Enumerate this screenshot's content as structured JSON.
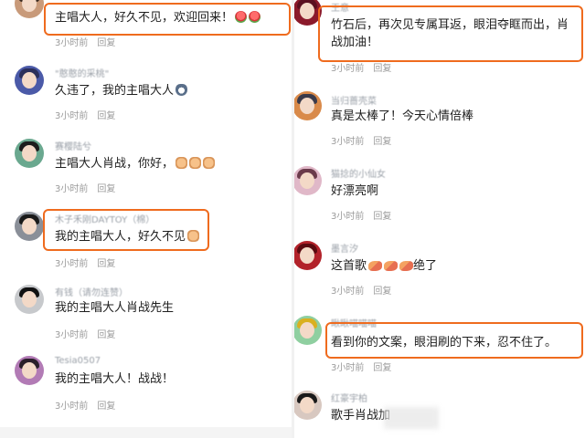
{
  "left_comments": [
    {
      "username": "",
      "text": "主唱大人，好久不见，欢迎回来！",
      "emojis": [
        "flower",
        "flower"
      ],
      "time": "3小时前",
      "reply": "回复",
      "avatar_hair": "#3a2a20",
      "avatar_bg": "#c89a7a"
    },
    {
      "username": "\"憨憨的采桃\"",
      "text": "久违了，我的主唱大人",
      "emojis": [
        "cat"
      ],
      "time": "3小时前",
      "reply": "回复",
      "avatar_hair": "#2b2f5a",
      "avatar_bg": "#4b5aa8"
    },
    {
      "username": "赛樱陆兮",
      "text": "主唱大人肖战，你好，",
      "emojis": [
        "fist",
        "fist",
        "fist"
      ],
      "time": "3小时前",
      "reply": "回复",
      "avatar_hair": "#1d1d1d",
      "avatar_bg": "#6aa88f"
    },
    {
      "username": "木子禾刚DAYTOY（棉）",
      "text": "我的主唱大人，好久不见",
      "emojis": [
        "fist"
      ],
      "time": "3小时前",
      "reply": "回复",
      "avatar_hair": "#1a1a1a",
      "avatar_bg": "#8a8f98"
    },
    {
      "username": "有钱（请勿连赞）",
      "text": "我的主唱大人肖战先生",
      "emojis": [],
      "time": "3小时前",
      "reply": "回复",
      "avatar_hair": "#111",
      "avatar_bg": "#c7c9cc"
    },
    {
      "username": "Tesia0507",
      "text": "我的主唱大人！战战！",
      "emojis": [],
      "time": "3小时前",
      "reply": "回复",
      "avatar_hair": "#2a1f2a",
      "avatar_bg": "#b27bb5"
    }
  ],
  "right_comments": [
    {
      "username": "王意",
      "text": "竹石后，再次见专属耳返，眼泪夺眶而出，肖战加油！",
      "emojis": [],
      "time": "3小时前",
      "reply": "回复",
      "avatar_hair": "#5a1020",
      "avatar_bg": "#8b1a2b"
    },
    {
      "username": "当归蔷壳菜",
      "text": "真是太棒了！今天心情倍棒",
      "emojis": [],
      "time": "3小时前",
      "reply": "回复",
      "avatar_hair": "#3a3a4a",
      "avatar_bg": "#d98a4a"
    },
    {
      "username": "猫捻的小仙女",
      "text": "好漂亮啊",
      "emojis": [],
      "time": "3小时前",
      "reply": "回复",
      "avatar_hair": "#6a3a4a",
      "avatar_bg": "#e0b8c8"
    },
    {
      "username": "墨言汐",
      "text": "这首歌",
      "text_after": "绝了",
      "emojis": [
        "bean",
        "bean",
        "bean"
      ],
      "time": "3小时前",
      "reply": "回复",
      "avatar_hair": "#5a0a10",
      "avatar_bg": "#b2222a"
    },
    {
      "username": "瞅瞅喵喵喵",
      "text": "看到你的文案，眼泪刷的下来，忍不住了。",
      "emojis": [],
      "time": "3小时前",
      "reply": "回复",
      "avatar_hair": "#d9b020",
      "avatar_bg": "#8fcfa0"
    },
    {
      "username": "红豪宇柏",
      "text": "歌手肖战加",
      "emojis": [],
      "time": "",
      "reply": "",
      "avatar_hair": "#1a1a1a",
      "avatar_bg": "#d8c8c0"
    }
  ],
  "colors": {
    "highlight": "#ef6b1e",
    "meta": "#9b9b9b",
    "username": "#9aa0a8"
  }
}
